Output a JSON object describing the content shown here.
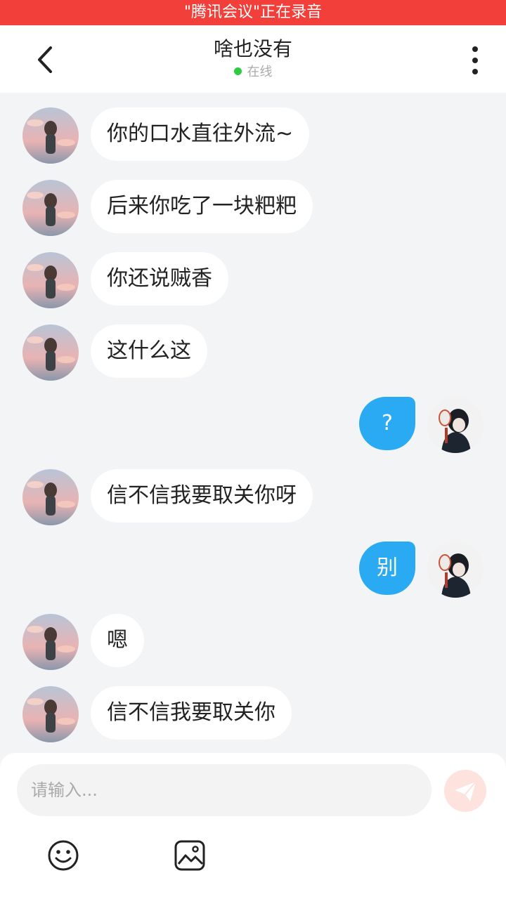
{
  "banner": {
    "text": "\"腾讯会议\"正在录音"
  },
  "header": {
    "title": "啥也没有",
    "status": "在线",
    "status_color": "#2ecc40"
  },
  "messages": [
    {
      "side": "left",
      "text": "你的口水直往外流~"
    },
    {
      "side": "left",
      "text": "后来你吃了一块粑粑"
    },
    {
      "side": "left",
      "text": "你还说贼香"
    },
    {
      "side": "left",
      "text": "这什么这"
    },
    {
      "side": "right",
      "text": "?"
    },
    {
      "side": "left",
      "text": "信不信我要取关你呀"
    },
    {
      "side": "right",
      "text": "别"
    },
    {
      "side": "left",
      "text": "嗯"
    },
    {
      "side": "left",
      "text": "信不信我要取关你"
    }
  ],
  "composer": {
    "placeholder": "请输入...",
    "send_icon": "send-icon",
    "tools": [
      "emoji-icon",
      "image-icon"
    ]
  },
  "colors": {
    "accent": "#2aaaf2",
    "banner": "#f23f3a",
    "background": "#f3f4f6"
  }
}
